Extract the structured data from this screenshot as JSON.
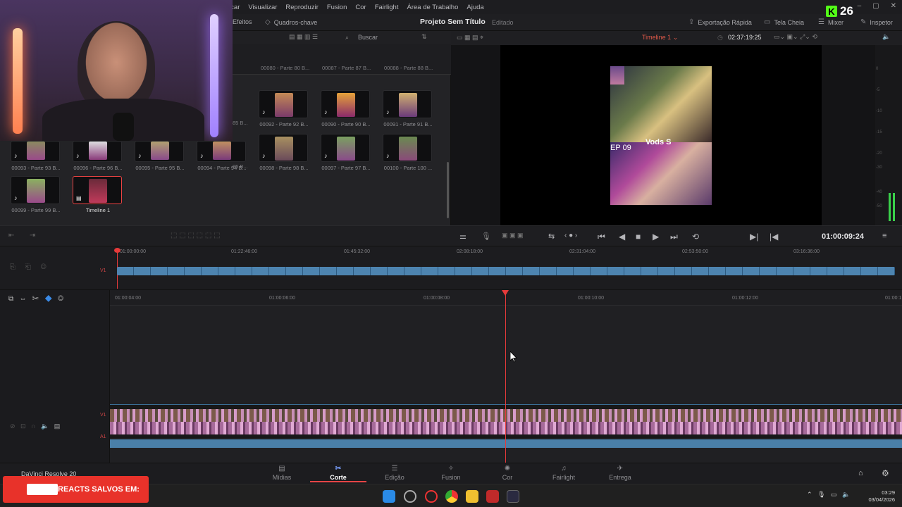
{
  "menu": [
    "rcar",
    "Visualizar",
    "Reproduzir",
    "Fusion",
    "Cor",
    "Fairlight",
    "Área de Trabalho",
    "Ajuda"
  ],
  "toolbar": {
    "effects": "Efeitos",
    "keyframes": "Quadros-chave",
    "project_title": "Projeto Sem Título",
    "project_status": "Editado",
    "quick_export": "Exportação Rápida",
    "fullscreen": "Tela Cheia",
    "mixer": "Mixer",
    "inspector": "Inspetor"
  },
  "mediapool": {
    "search": "Buscar",
    "top_labels": [
      "00080 - Parte 80 B...",
      "00087 - Parte 87 B...",
      "00088 - Parte 88 B..."
    ],
    "clips": [
      {
        "label": "00092 - Parte 92 B..."
      },
      {
        "label": "00090 - Parte 90 B..."
      },
      {
        "label": "00091 - Parte 91 B..."
      },
      {
        "label": "00093 - Parte 93 B..."
      },
      {
        "label": "00096 - Parte 96 B..."
      },
      {
        "label": "00095 - Parte 95 B..."
      },
      {
        "label": "00094 - Parte 94 B..."
      },
      {
        "label": "00098 - Parte 98 B..."
      },
      {
        "label": "00097 - Parte 97 B..."
      },
      {
        "label": "00100 - Parte 100 ..."
      },
      {
        "label": "00099 - Parte 99 B..."
      },
      {
        "label": "Timeline 1"
      }
    ],
    "partial_labels": [
      "85 B...",
      "85 B..."
    ]
  },
  "viewer": {
    "timeline_name": "Timeline 1",
    "duration": "02:37:19:25",
    "overlay_ep": "EP 09",
    "overlay_vods": "Vods S"
  },
  "meters": [
    "0",
    "-5",
    "-10",
    "-15",
    "-20",
    "-30",
    "-40",
    "-50"
  ],
  "transport": {
    "timecode": "01:00:09:24"
  },
  "upper_ruler": [
    "01:00:00:00",
    "01:22:46:00",
    "01:45:32:00",
    "02:08:18:00",
    "02:31:04:00",
    "02:53:50:00",
    "03:16:36:00"
  ],
  "lower_ruler": [
    "01:00:04:00",
    "01:00:06:00",
    "01:00:08:00",
    "01:00:10:00",
    "01:00:12:00",
    "01:00:1"
  ],
  "tracks": {
    "v1": "V1",
    "a1": "A1"
  },
  "pages": [
    {
      "label": "Mídias",
      "icon": "media-icon"
    },
    {
      "label": "Corte",
      "icon": "cut-icon"
    },
    {
      "label": "Edição",
      "icon": "edit-icon"
    },
    {
      "label": "Fusion",
      "icon": "fusion-icon"
    },
    {
      "label": "Cor",
      "icon": "color-icon"
    },
    {
      "label": "Fairlight",
      "icon": "fairlight-icon"
    },
    {
      "label": "Entrega",
      "icon": "deliver-icon"
    }
  ],
  "davinci_label": "DaVinci Resolve 20",
  "overlay": {
    "badge_number": "26",
    "banner": "REACTS SALVOS EM:"
  },
  "clock": {
    "time": "03:29",
    "date": "03/04/2026"
  },
  "colors": {
    "accent": "#e64545",
    "brand_green": "#53fc18",
    "track_blue": "#4d84b0"
  }
}
